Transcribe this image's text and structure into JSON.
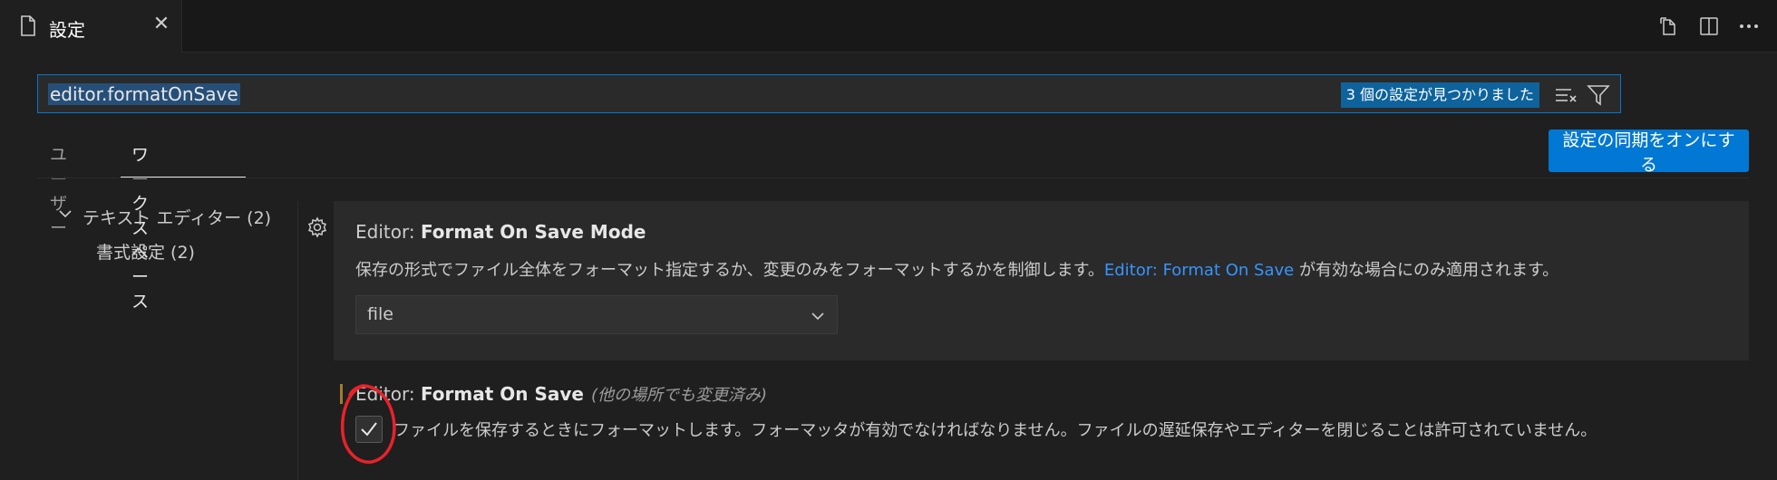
{
  "tab": {
    "title": "設定",
    "close": "✕"
  },
  "editor_actions": [
    "open-settings-json",
    "split-editor",
    "more-actions"
  ],
  "search": {
    "value": "editor.formatOnSave",
    "count": "3 個の設定が見つかりました"
  },
  "scope_tabs": [
    {
      "label": "ユーザー",
      "active": false
    },
    {
      "label": "ワークスペース",
      "active": true
    }
  ],
  "sync_button": "設定の同期をオンにする",
  "toc": {
    "group": "テキスト エディター (2)",
    "child": "書式設定 (2)"
  },
  "settings": [
    {
      "category": "Editor: ",
      "name": "Format On Save Mode",
      "description_pre": "保存の形式でファイル全体をフォーマット指定するか、変更のみをフォーマットするかを制御します。",
      "description_link": "Editor: Format On Save",
      "description_post": " が有効な場合にのみ適用されます。",
      "value": "file"
    },
    {
      "category": "Editor: ",
      "name": "Format On Save",
      "modified_note": "(他の場所でも変更済み)",
      "description": "ファイルを保存するときにフォーマットします。フォーマッタが有効でなければなりません。ファイルの遅延保存やエディターを閉じることは許可されていません。",
      "checked": true
    }
  ],
  "colors": {
    "accent": "#0078d4",
    "link": "#3794ff",
    "annotation": "#e8222b",
    "modified": "#a07c2c"
  }
}
